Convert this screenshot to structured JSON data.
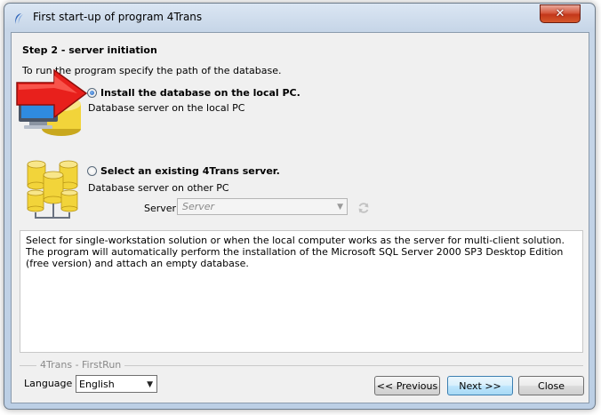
{
  "window": {
    "title": "First start-up of program 4Trans",
    "close_glyph": "✕"
  },
  "step": {
    "title": "Step 2 - server initiation",
    "intro": "To run the program specify the path of the database."
  },
  "options": [
    {
      "label": "Install the database on the local PC.",
      "sublabel": "Database server on the local PC",
      "selected": true,
      "icon": "local-pc-database-icon"
    },
    {
      "label": "Select an existing 4Trans server.",
      "sublabel": "Database server on other PC",
      "selected": false,
      "icon": "network-databases-icon"
    }
  ],
  "server": {
    "label": "Server:",
    "value": "Server",
    "enabled": false
  },
  "description": "Select for single-workstation solution or when the local computer works as the server for multi-client solution. The program will automatically perform the installation of the Microsoft SQL Server 2000 SP3 Desktop Edition (free version) and attach an empty database.",
  "footer": {
    "group_label": "4Trans - FirstRun",
    "language_label": "Language",
    "language_value": "English",
    "buttons": {
      "previous": "<< Previous",
      "next": "Next >>",
      "close": "Close"
    }
  },
  "colors": {
    "arrow": "#e8201c",
    "database": "#f2d43a",
    "window_frame": "#c7d6e8",
    "close_button": "#c8472b"
  }
}
